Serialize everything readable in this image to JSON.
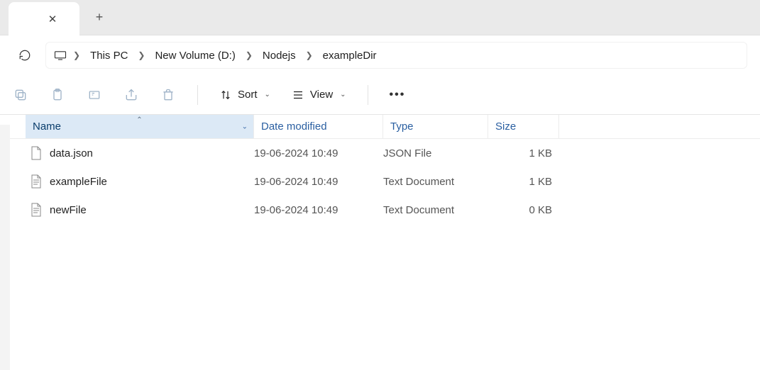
{
  "tab": {
    "title": "",
    "close": "✕",
    "new": "+"
  },
  "breadcrumb": {
    "items": [
      "This PC",
      "New Volume (D:)",
      "Nodejs",
      "exampleDir"
    ]
  },
  "toolbar": {
    "sort_label": "Sort",
    "view_label": "View"
  },
  "columns": {
    "name": "Name",
    "date": "Date modified",
    "type": "Type",
    "size": "Size"
  },
  "files": [
    {
      "name": "data.json",
      "date": "19-06-2024 10:49",
      "type": "JSON File",
      "size": "1 KB",
      "icon": "blank"
    },
    {
      "name": "exampleFile",
      "date": "19-06-2024 10:49",
      "type": "Text Document",
      "size": "1 KB",
      "icon": "text"
    },
    {
      "name": "newFile",
      "date": "19-06-2024 10:49",
      "type": "Text Document",
      "size": "0 KB",
      "icon": "text"
    }
  ]
}
